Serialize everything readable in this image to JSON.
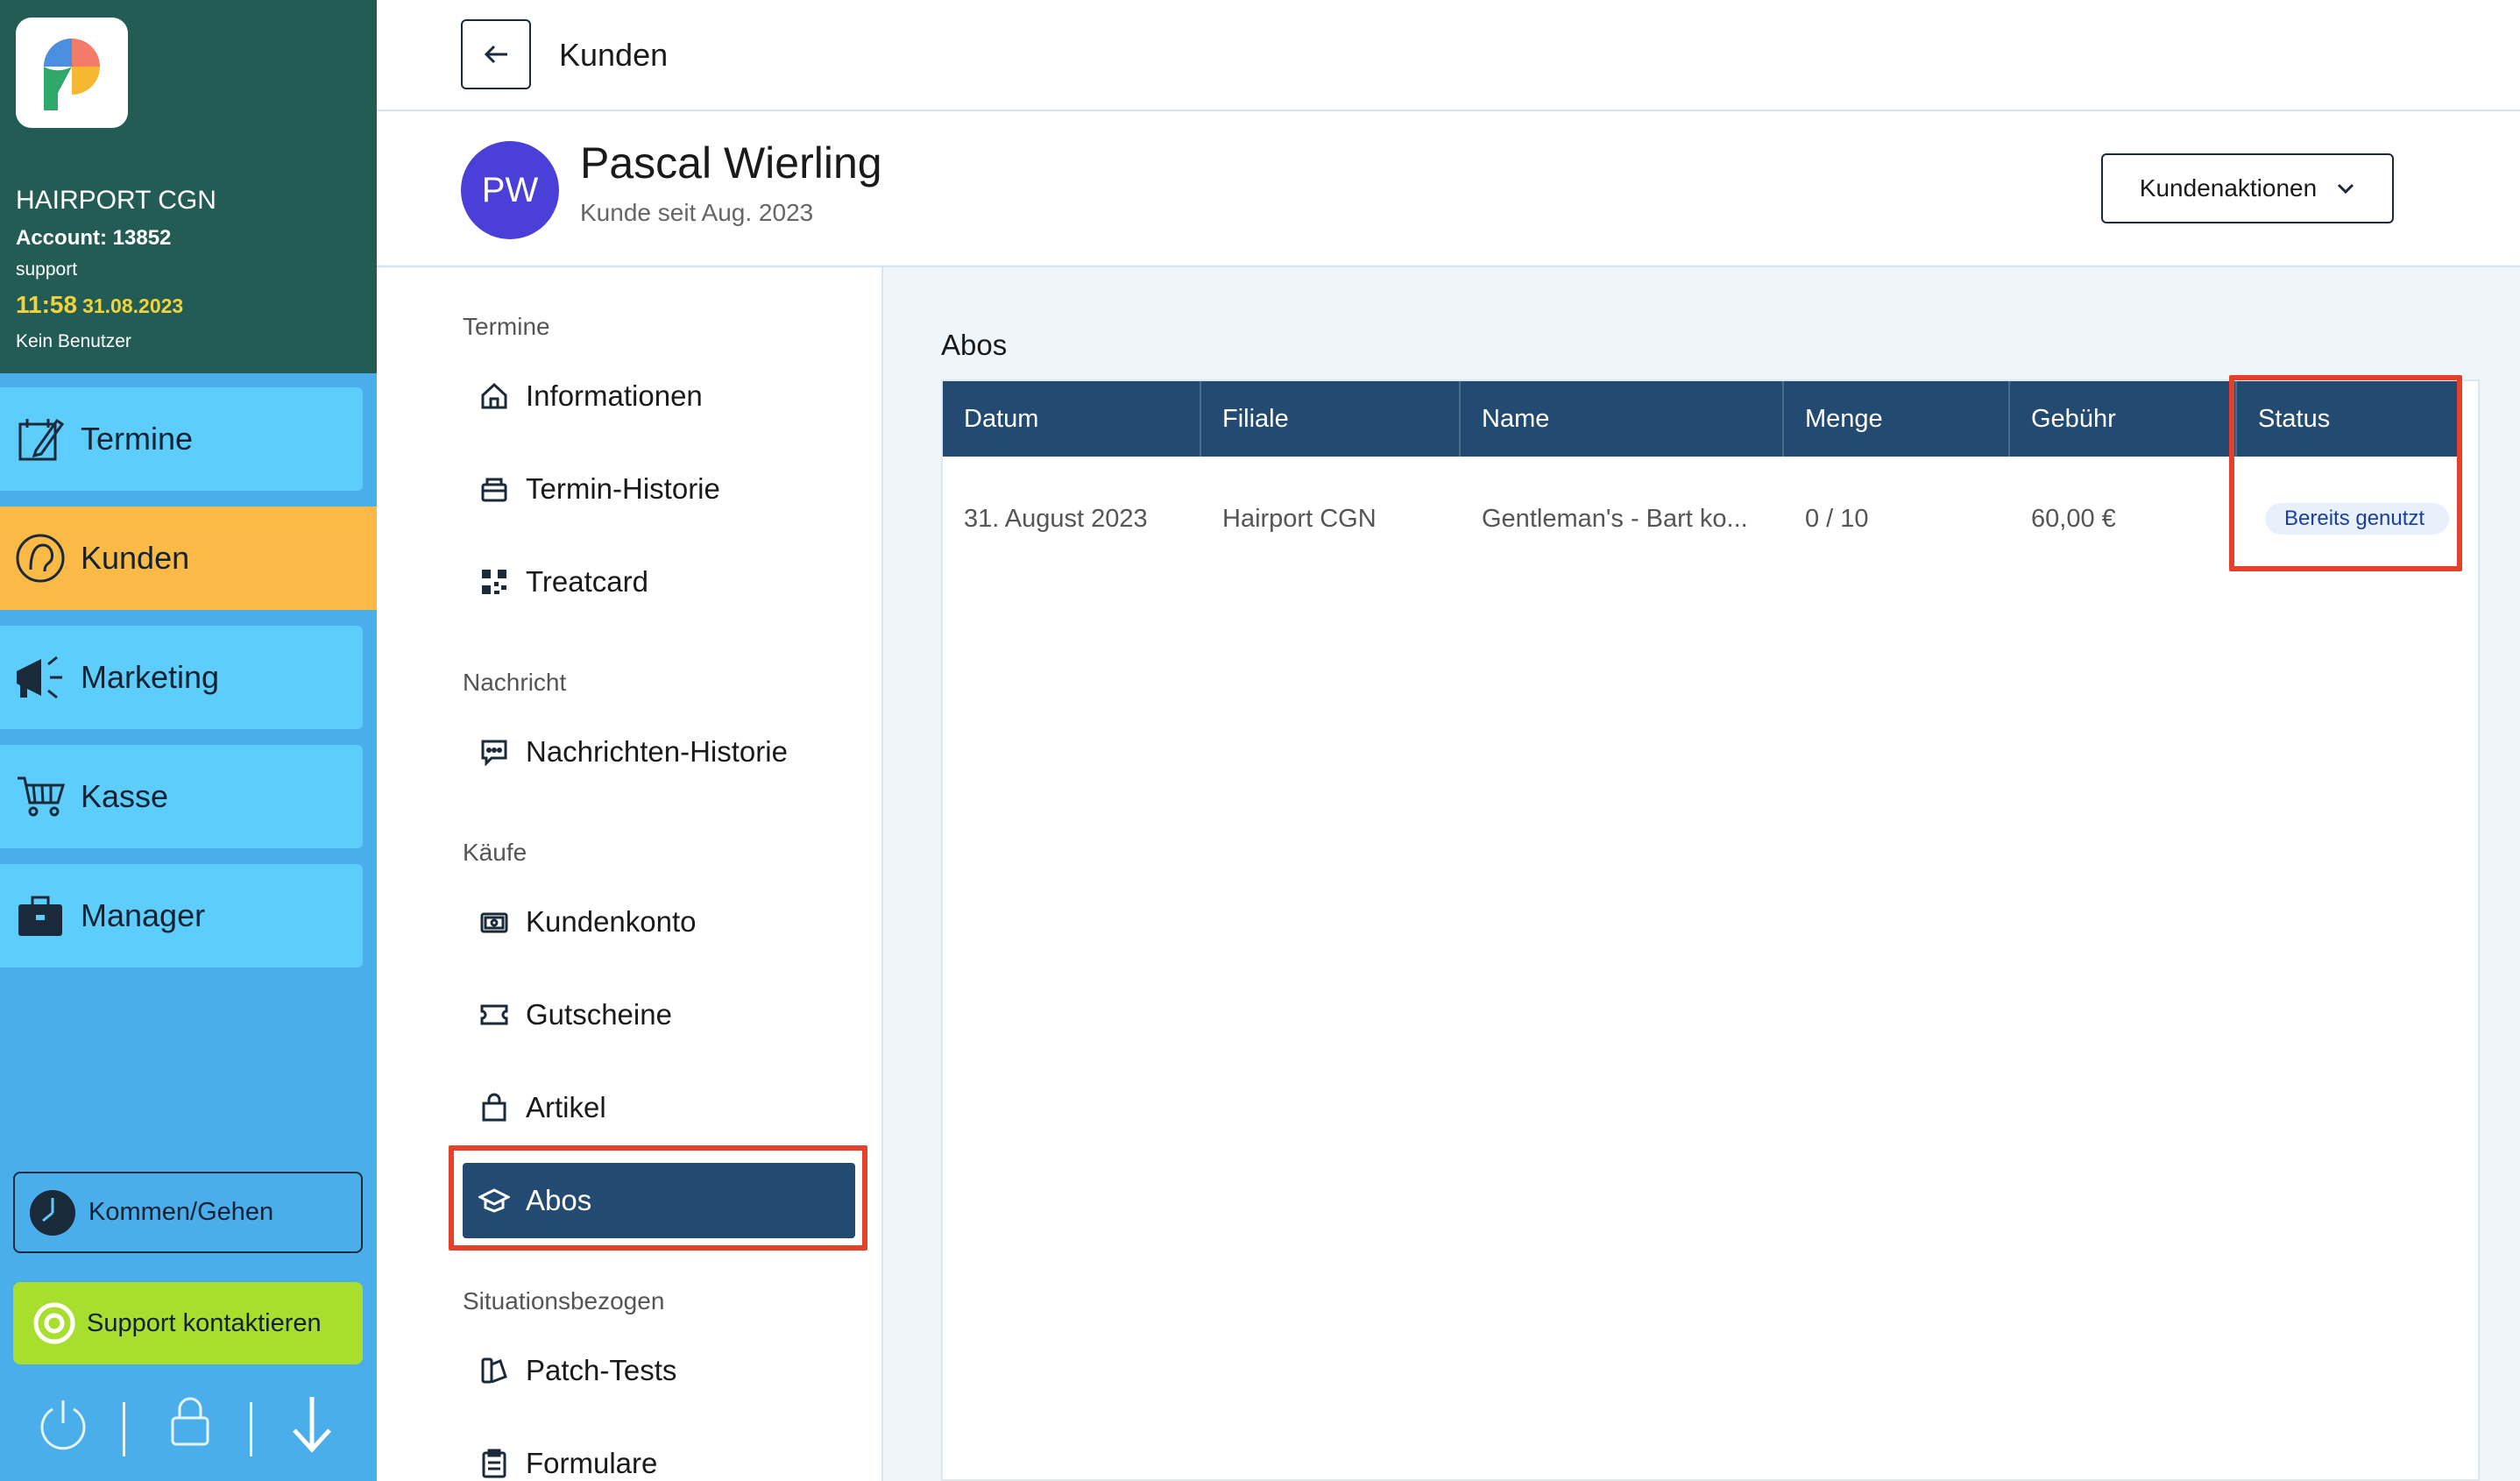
{
  "sidebar": {
    "salon_name": "HAIRPORT CGN",
    "account": "Account: 13852",
    "role": "support",
    "time": "11:58",
    "date": "31.08.2023",
    "user": "Kein Benutzer",
    "nav": [
      {
        "label": "Termine",
        "icon": "calendar-edit-icon"
      },
      {
        "label": "Kunden",
        "icon": "customer-head-icon"
      },
      {
        "label": "Marketing",
        "icon": "megaphone-icon"
      },
      {
        "label": "Kasse",
        "icon": "cart-icon"
      },
      {
        "label": "Manager",
        "icon": "briefcase-icon"
      }
    ],
    "active_nav": "Kunden",
    "clock_button": "Kommen/Gehen",
    "support_button": "Support kontaktieren",
    "bottom_icons": [
      "power-icon",
      "lock-icon",
      "arrow-down-icon"
    ]
  },
  "header": {
    "title": "Kunden",
    "back_icon": "arrow-left-icon"
  },
  "customer": {
    "initials": "PW",
    "name": "Pascal Wierling",
    "since": "Kunde seit Aug. 2023",
    "actions_label": "Kundenaktionen"
  },
  "subnav": {
    "sections": [
      {
        "title": "Termine",
        "items": [
          {
            "label": "Informationen",
            "icon": "home-icon"
          },
          {
            "label": "Termin-Historie",
            "icon": "bag-icon"
          },
          {
            "label": "Treatcard",
            "icon": "qr-code-icon"
          }
        ]
      },
      {
        "title": "Nachricht",
        "items": [
          {
            "label": "Nachrichten-Historie",
            "icon": "message-icon"
          }
        ]
      },
      {
        "title": "Käufe",
        "items": [
          {
            "label": "Kundenkonto",
            "icon": "wallet-icon"
          },
          {
            "label": "Gutscheine",
            "icon": "ticket-icon"
          },
          {
            "label": "Artikel",
            "icon": "shopping-bag-icon"
          },
          {
            "label": "Abos",
            "icon": "graduation-cap-icon"
          }
        ]
      },
      {
        "title": "Situationsbezogen",
        "items": [
          {
            "label": "Patch-Tests",
            "icon": "swatch-icon"
          },
          {
            "label": "Formulare",
            "icon": "clipboard-icon"
          }
        ]
      }
    ],
    "active_item": "Abos"
  },
  "abos": {
    "title": "Abos",
    "columns": [
      "Datum",
      "Filiale",
      "Name",
      "Menge",
      "Gebühr",
      "Status"
    ],
    "rows": [
      {
        "Datum": "31. August 2023",
        "Filiale": "Hairport CGN",
        "Name": "Gentleman's - Bart ko...",
        "Menge": "0 / 10",
        "Gebühr": "60,00 €",
        "Status": "Bereits genutzt"
      }
    ]
  },
  "colors": {
    "brand_dark": "#235c55",
    "sidebar_bg": "#4aaeea",
    "nav_button": "#5dcdfb",
    "nav_active": "#fbb946",
    "support_green": "#a8df2f",
    "table_header": "#234a70",
    "avatar": "#4a3fd8",
    "highlight": "#e5412a"
  }
}
